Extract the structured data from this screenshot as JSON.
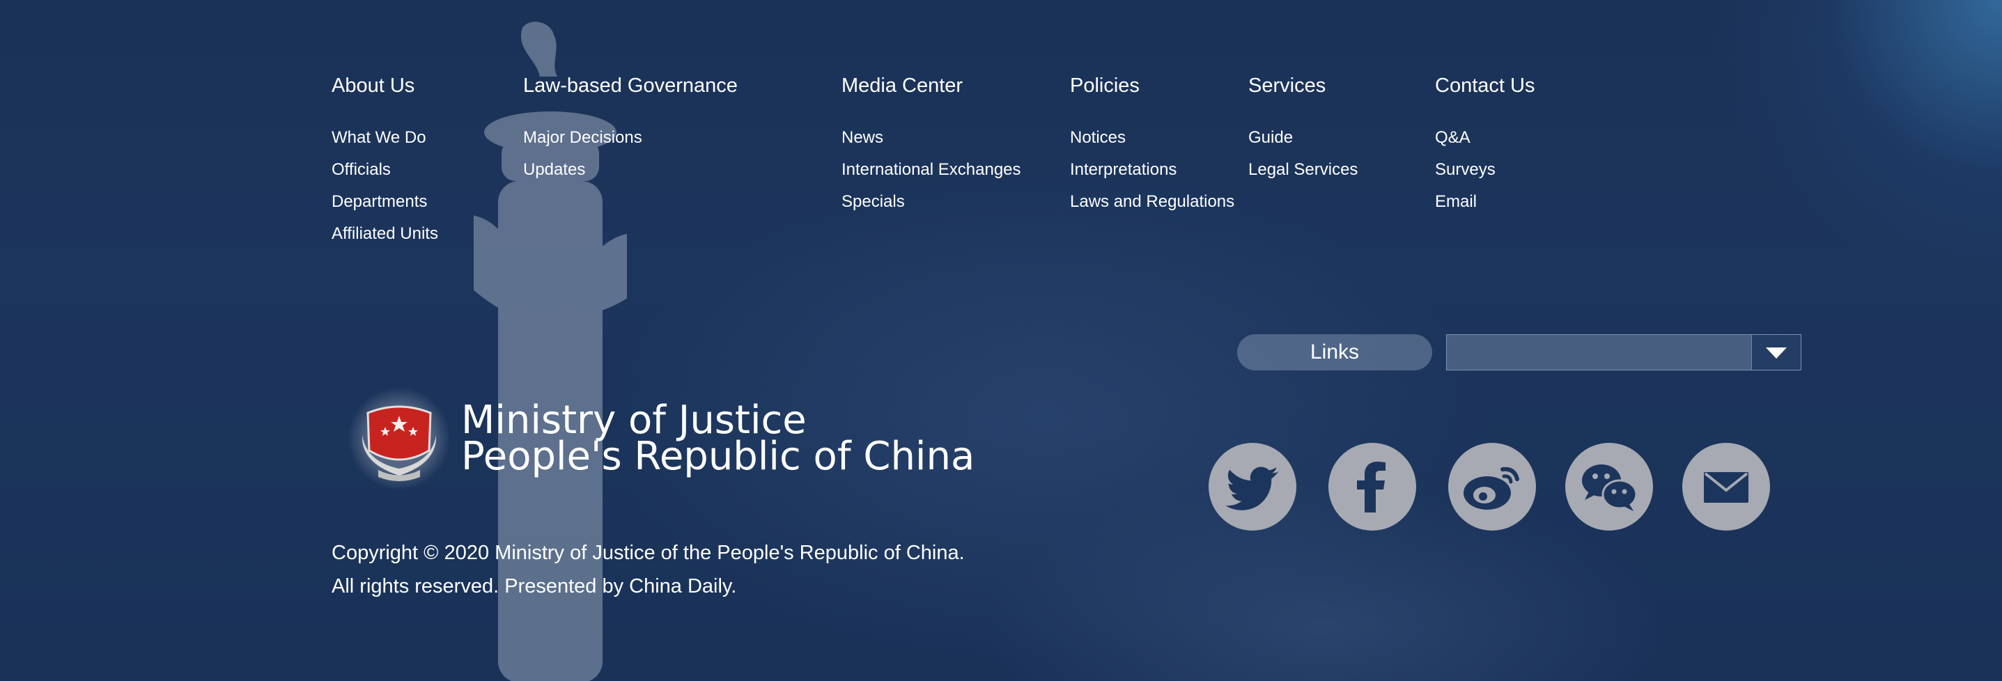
{
  "nav": {
    "columns": [
      {
        "title": "About Us",
        "items": [
          "What We Do",
          "Officials",
          "Departments",
          "Affiliated Units"
        ]
      },
      {
        "title": "Law-based Governance",
        "items": [
          "Major Decisions",
          "Updates"
        ]
      },
      {
        "title": "Media Center",
        "items": [
          "News",
          "International Exchanges",
          "Specials"
        ]
      },
      {
        "title": "Policies",
        "items": [
          "Notices",
          "Interpretations",
          "Laws and Regulations"
        ]
      },
      {
        "title": "Services",
        "items": [
          "Guide",
          "Legal Services"
        ]
      },
      {
        "title": "Contact Us",
        "items": [
          "Q&A",
          "Surveys",
          "Email"
        ]
      }
    ]
  },
  "links": {
    "label": "Links",
    "selected": ""
  },
  "org": {
    "line1": "Ministry of Justice",
    "line2": "People's Republic of China"
  },
  "copyright": {
    "line1": "Copyright © 2020 Ministry of Justice of the People's Republic of China.",
    "line2": "All rights reserved. Presented by China Daily."
  },
  "social": [
    {
      "icon": "twitter-icon"
    },
    {
      "icon": "facebook-icon"
    },
    {
      "icon": "weibo-icon"
    },
    {
      "icon": "wechat-icon"
    },
    {
      "icon": "email-icon"
    }
  ],
  "colors": {
    "background": "#1a3157",
    "social_circle": "#a7aab3",
    "social_glyph": "#1c355c",
    "emblem_red": "#c8241f"
  }
}
